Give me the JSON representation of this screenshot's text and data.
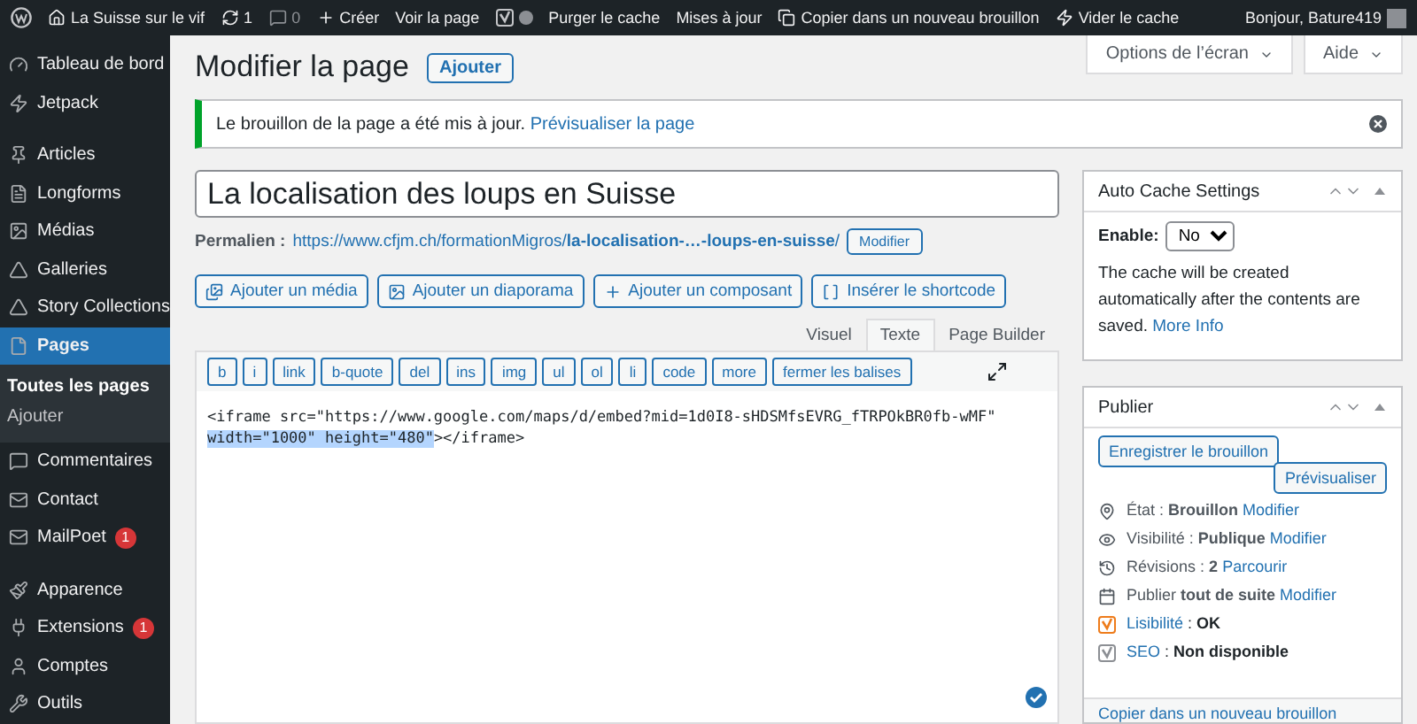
{
  "admin_bar": {
    "site": "La Suisse sur le vif",
    "updates": "1",
    "comments": "0",
    "new": "Créer",
    "items": [
      {
        "kind": "link",
        "label": "Voir la page"
      },
      {
        "kind": "yoast"
      },
      {
        "kind": "link",
        "label": "Purger le cache"
      },
      {
        "kind": "link",
        "label": "Mises à jour"
      },
      {
        "kind": "copy",
        "label": "Copier dans un nouveau brouillon"
      },
      {
        "kind": "cache",
        "label": "Vider le cache"
      }
    ],
    "greeting": "Bonjour, Bature419"
  },
  "sidebar": {
    "groups": [
      {
        "items": [
          {
            "label": "Tableau de bord",
            "selected": false
          },
          {
            "label": "Jetpack",
            "selected": false
          }
        ]
      },
      {
        "items": [
          {
            "label": "Articles",
            "selected": false
          },
          {
            "label": "Longforms",
            "selected": false
          },
          {
            "label": "Médias",
            "selected": false
          },
          {
            "label": "Galleries",
            "selected": false
          },
          {
            "label": "Story Collections",
            "selected": false
          },
          {
            "label": "Pages",
            "selected": true,
            "children": [
              {
                "label": "Toutes les pages",
                "selected": true
              },
              {
                "label": "Ajouter",
                "selected": false
              }
            ]
          },
          {
            "label": "Commentaires",
            "selected": false
          },
          {
            "label": "Contact",
            "selected": false
          },
          {
            "label": "MailPoet",
            "selected": false,
            "badge": "1"
          }
        ]
      },
      {
        "items": [
          {
            "label": "Apparence",
            "selected": false
          },
          {
            "label": "Extensions",
            "selected": false,
            "badge": "1"
          },
          {
            "label": "Comptes",
            "selected": false
          },
          {
            "label": "Outils",
            "selected": false
          }
        ]
      }
    ]
  },
  "header": {
    "title": "Modifier la page",
    "add_button": "Ajouter",
    "screen_options": "Options de l’écran",
    "help": "Aide"
  },
  "notice": {
    "text": "Le brouillon de la page a été mis à jour.",
    "link": "Prévisualiser la page"
  },
  "editor": {
    "title": "La localisation des loups en Suisse",
    "permalink_label": "Permalien :",
    "permalink_base": "https://www.cfjm.ch/formationMigros/",
    "permalink_slug": "la-localisation-…-loups-en-suisse",
    "permalink_end": "/",
    "permalink_button": "Modifier",
    "media_buttons": [
      "Ajouter un média",
      "Ajouter un diaporama",
      "Ajouter un composant",
      "Insérer le shortcode"
    ],
    "tabs": [
      {
        "label": "Visuel",
        "selected": false
      },
      {
        "label": "Texte",
        "selected": true
      },
      {
        "label": "Page Builder",
        "selected": false
      }
    ],
    "quicktags": [
      "b",
      "i",
      "link",
      "b-quote",
      "del",
      "ins",
      "img",
      "ul",
      "ol",
      "li",
      "code",
      "more",
      "fermer les balises"
    ],
    "code_lines": [
      [
        {
          "text": "<iframe src=\"https://www.google.com/maps/d/embed?mid=1d0I8-sHDSMfsEVRG_fTRPOkBR0fb-wMF\"",
          "highlighted": false
        }
      ],
      [
        {
          "text": "width=\"1000\" height=\"480\"",
          "highlighted": true
        },
        {
          "text": "></iframe>",
          "highlighted": false
        }
      ]
    ]
  },
  "cache_box": {
    "title": "Auto Cache Settings",
    "enable_label": "Enable:",
    "enable_value": "No",
    "text": "The cache will be created automatically after the contents are saved.",
    "link": "More Info"
  },
  "publish_box": {
    "title": "Publier",
    "save_draft": "Enregistrer le brouillon",
    "preview": "Prévisualiser",
    "rows": [
      {
        "kind": "status",
        "text": "État : **Brouillon**",
        "link": "Modifier"
      },
      {
        "kind": "visibility",
        "text": "Visibilité : **Publique**",
        "link": "Modifier"
      },
      {
        "kind": "revisions",
        "text": "Révisions : **2**",
        "link": "Parcourir"
      },
      {
        "kind": "schedule",
        "text": "Publier **tout de suite**",
        "link": "Modifier"
      },
      {
        "kind": "score",
        "link": "Lisibilité",
        "text": ": **OK**",
        "color": "#ee7c1b"
      },
      {
        "kind": "score",
        "link": "SEO",
        "text": ": **Non disponible**",
        "color": "#8c8f94"
      }
    ],
    "footer_link": "Copier dans un nouveau brouillon"
  }
}
